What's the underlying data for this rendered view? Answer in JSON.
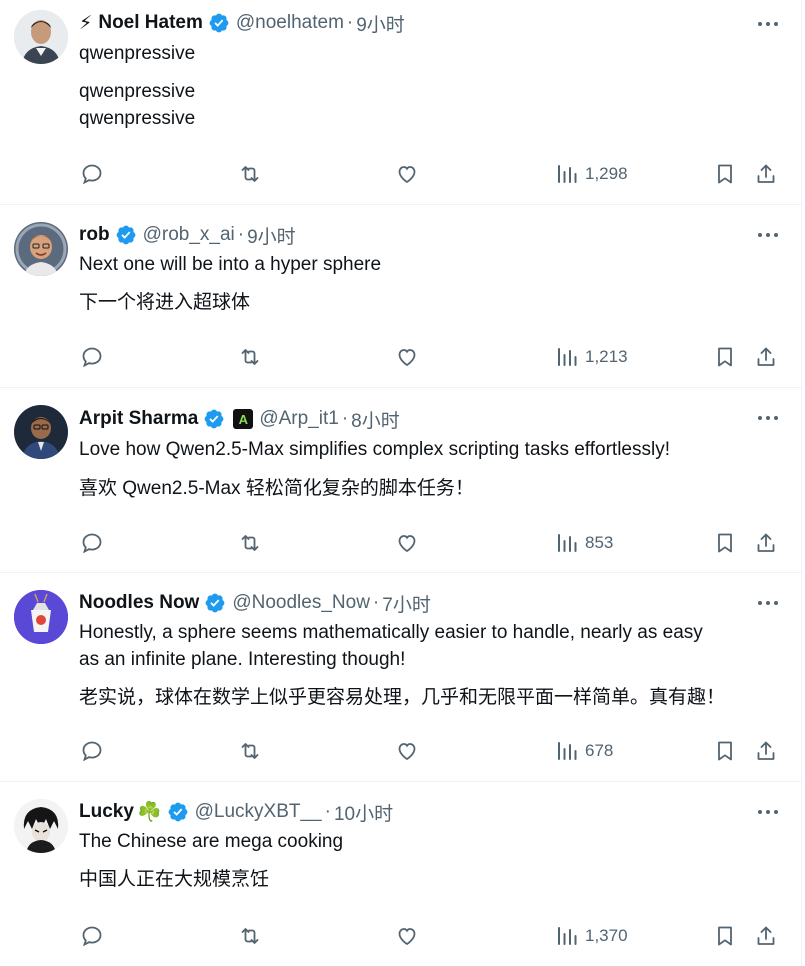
{
  "tweets": [
    {
      "name": "Noel Hatem",
      "emoji_prefix": "⚡",
      "handle": "@noelhatem",
      "separator": "·",
      "time": "9小时",
      "lines": [
        "qwenpressive",
        "qwenpressive",
        "qwenpressive"
      ],
      "views": "1,298"
    },
    {
      "name": "rob",
      "handle": "@rob_x_ai",
      "separator": "·",
      "time": "9小时",
      "lines": [
        "Next one will be into a hyper sphere",
        "下一个将进入超球体"
      ],
      "views": "1,213"
    },
    {
      "name": "Arpit Sharma",
      "badge_letter": "A",
      "handle": "@Arp_it1",
      "separator": "·",
      "time": "8小时",
      "lines": [
        "Love how Qwen2.5-Max simplifies complex scripting tasks effortlessly!",
        "喜欢 Qwen2.5-Max 轻松简化复杂的脚本任务！"
      ],
      "views": "853"
    },
    {
      "name": "Noodles Now",
      "handle": "@Noodles_Now",
      "separator": "·",
      "time": "7小时",
      "lines": [
        "Honestly, a sphere seems mathematically easier to handle, nearly as easy",
        "as an infinite plane. Interesting though!",
        "老实说，球体在数学上似乎更容易处理，几乎和无限平面一样简单。真有趣！"
      ],
      "views": "678"
    },
    {
      "name": "Lucky",
      "emoji_suffix": "☘️",
      "handle": "@LuckyXBT__",
      "separator": "·",
      "time": "10小时",
      "lines": [
        "The Chinese are mega cooking",
        "中国人正在大规模烹饪"
      ],
      "views": "1,370"
    }
  ],
  "icons": {
    "reply": "reply-icon",
    "retweet": "retweet-icon",
    "like": "like-icon",
    "views": "views-icon",
    "bookmark": "bookmark-icon",
    "share": "share-icon",
    "more": "more-icon",
    "verified": "verified-badge-icon"
  },
  "colors": {
    "verified": "#1d9bf0",
    "secondary_text": "#536471",
    "divider": "#eff3f4"
  }
}
